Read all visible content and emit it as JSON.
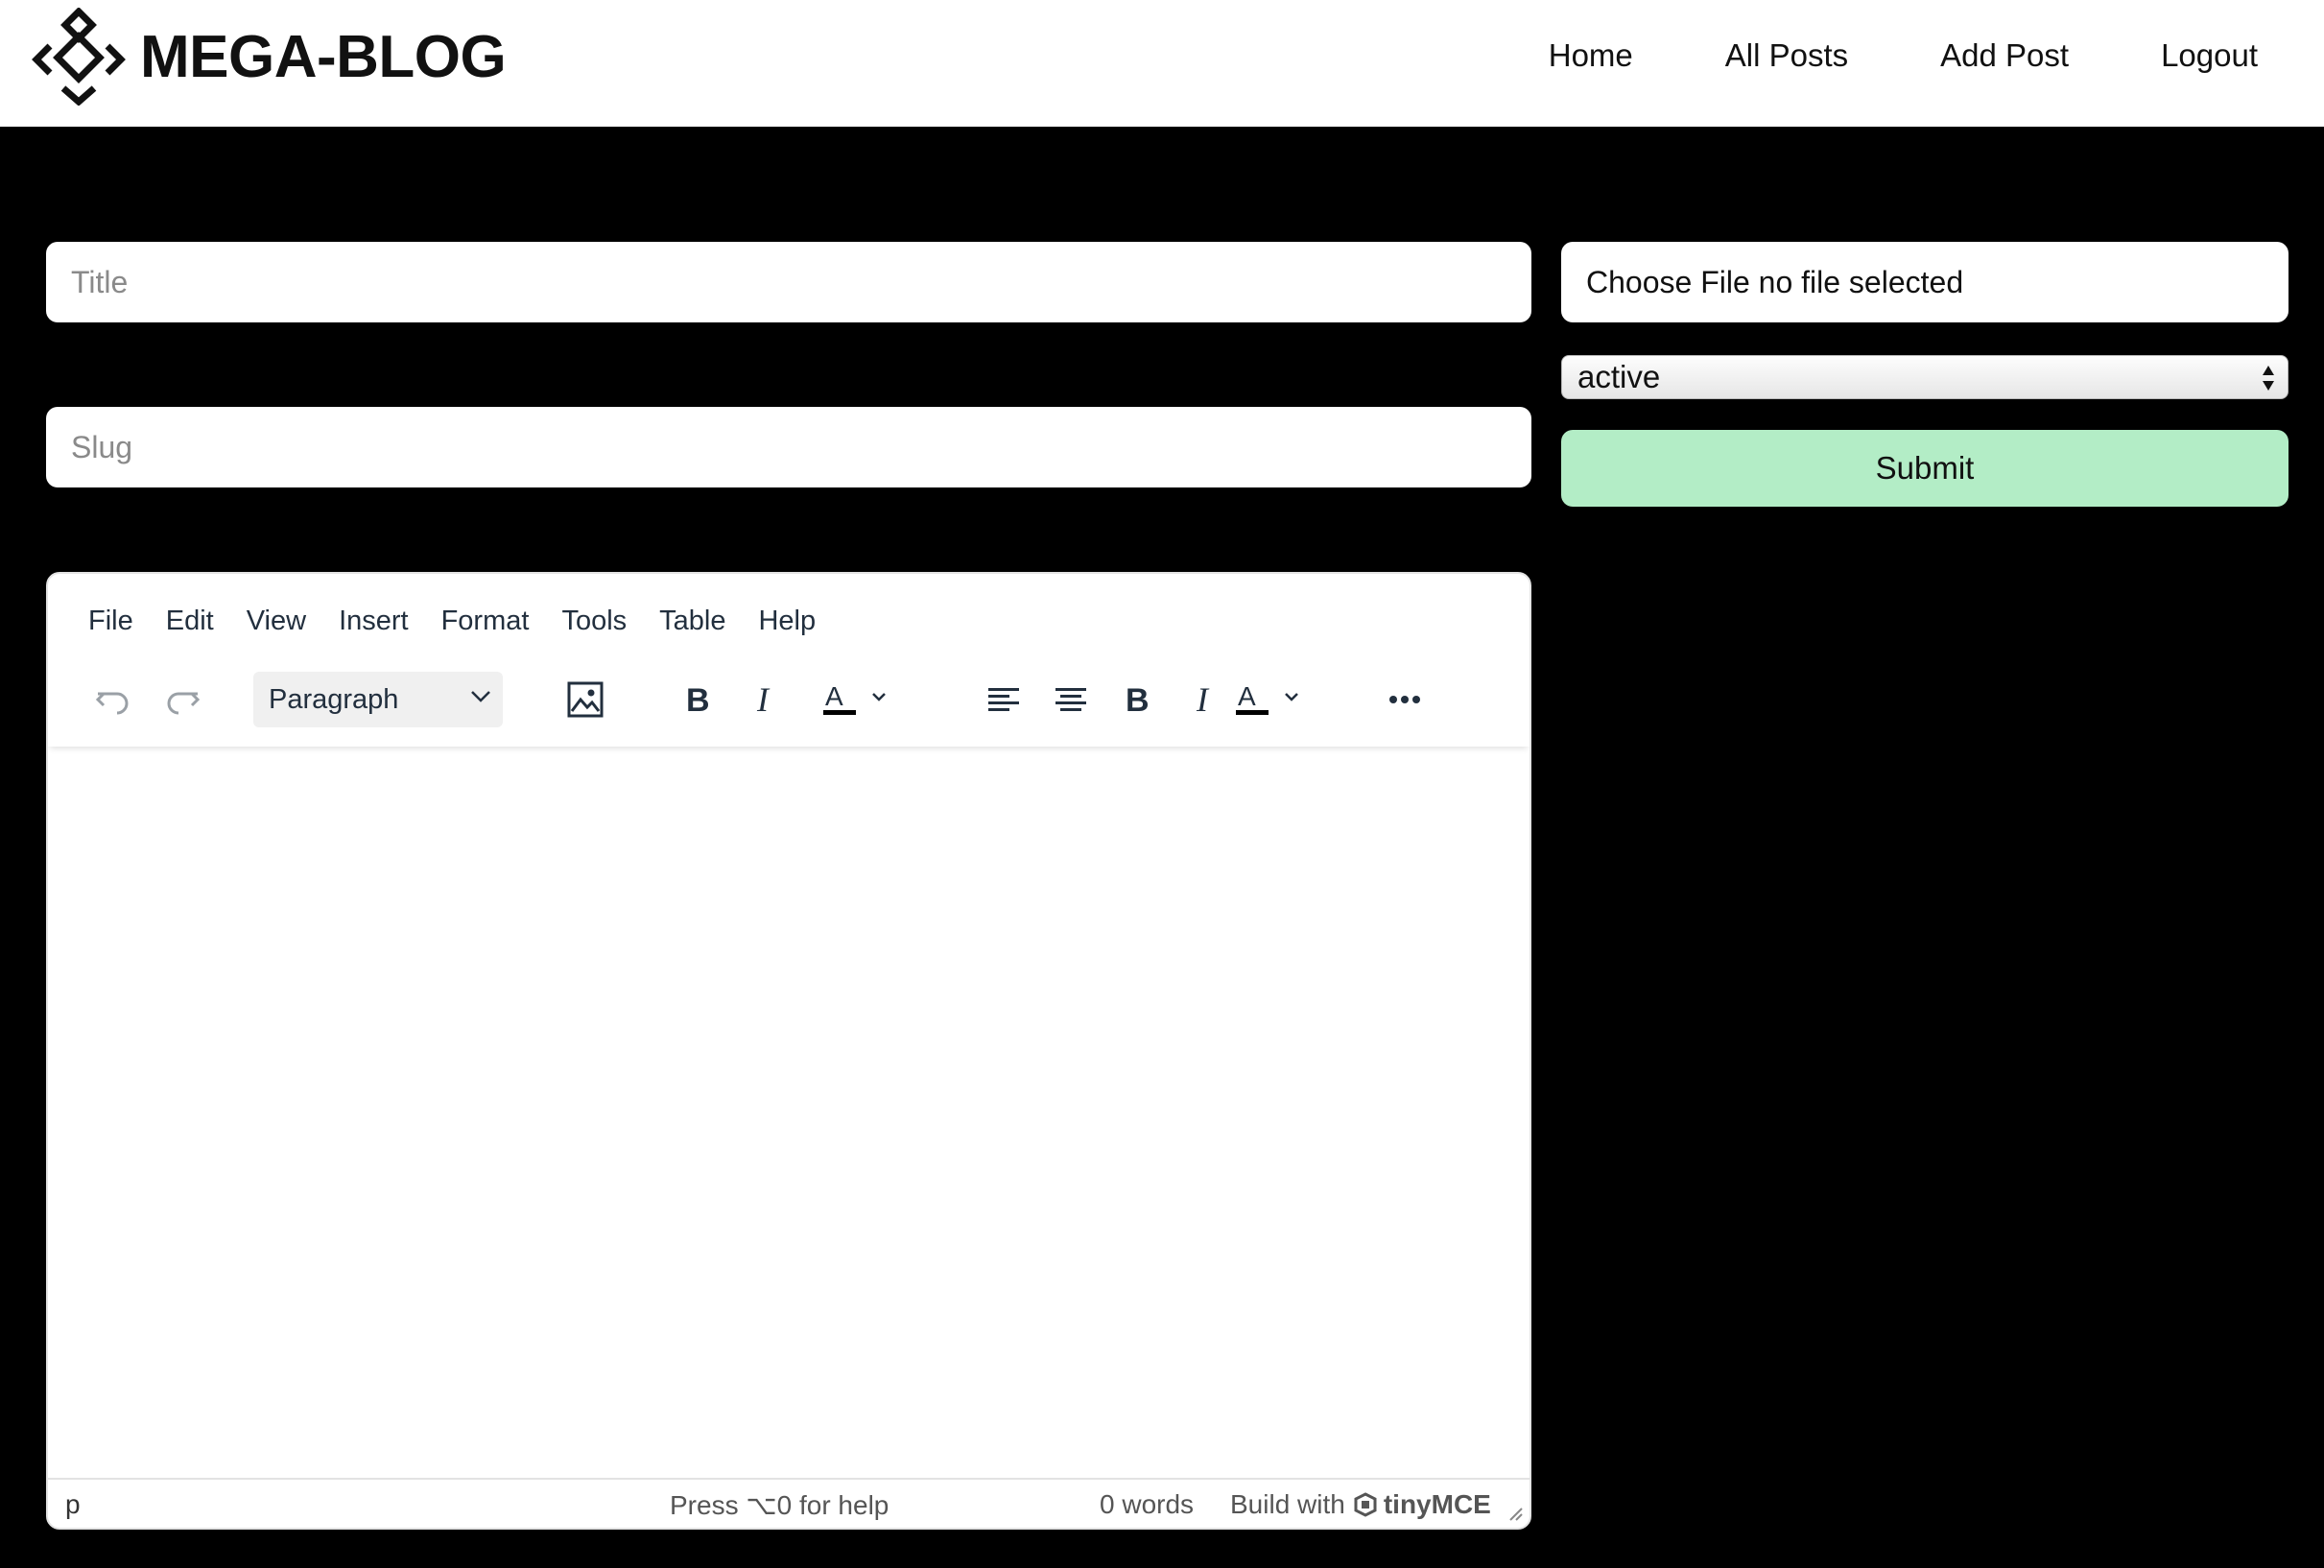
{
  "header": {
    "logo_text": "MEGA-BLOG",
    "nav": [
      "Home",
      "All Posts",
      "Add Post",
      "Logout"
    ]
  },
  "form": {
    "title_placeholder": "Title",
    "slug_placeholder": "Slug",
    "file_label": "Choose File no file selected",
    "status_value": "active",
    "submit_label": "Submit",
    "submit_color": "#b3edc6"
  },
  "editor": {
    "menu": [
      "File",
      "Edit",
      "View",
      "Insert",
      "Format",
      "Tools",
      "Table",
      "Help"
    ],
    "block_format": "Paragraph",
    "toolbar_icons": [
      "undo-icon",
      "redo-icon",
      "image-icon",
      "bold-icon",
      "italic-icon",
      "text-color-icon",
      "align-left-icon",
      "align-center-icon",
      "bold-icon",
      "italic-icon",
      "text-color-icon",
      "more-icon"
    ],
    "status_path": "p",
    "status_help": "Press ⌥0 for help",
    "status_words": "0 words",
    "status_brand_prefix": "Build with",
    "status_brand": "tinyMCE"
  }
}
